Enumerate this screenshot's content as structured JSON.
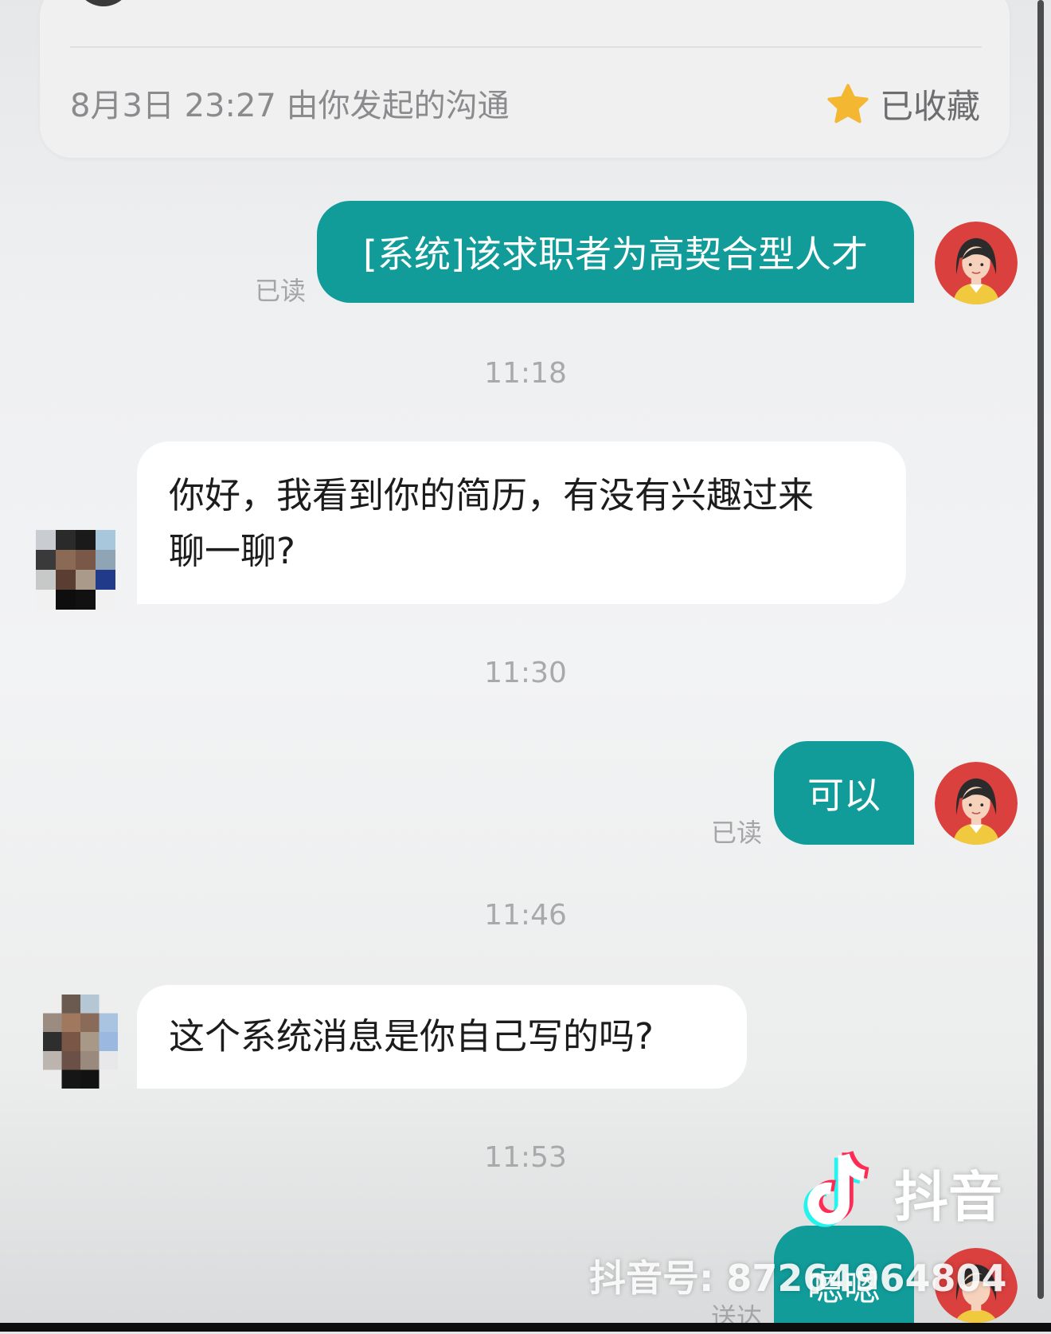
{
  "header": {
    "info_text": "8月3日 23:27 由你发起的沟通",
    "favorite_label": "已收藏",
    "favorite_color": "#f4b731"
  },
  "messages": [
    {
      "side": "out",
      "text": "[系统]该求职者为高契合型人才",
      "status": "已读"
    },
    {
      "type": "time",
      "text": "11:18"
    },
    {
      "side": "in",
      "line1": "你好，我看到你的简历，有没有兴趣过来",
      "line2": "聊一聊?"
    },
    {
      "type": "time",
      "text": "11:30"
    },
    {
      "side": "out",
      "text": "可以",
      "status": "已读"
    },
    {
      "type": "time",
      "text": "11:46"
    },
    {
      "side": "in",
      "text": "这个系统消息是你自己写的吗?"
    },
    {
      "type": "time",
      "text": "11:53"
    },
    {
      "side": "out",
      "text": "嗯嗯",
      "status": "送达"
    }
  ],
  "watermark": {
    "brand": "抖音",
    "account": "抖音号: 87264964804"
  },
  "colors": {
    "accent": "#119c9a",
    "avatar_bg": "#d9403e"
  },
  "icons": {
    "favorite": "star-icon",
    "brand_logo": "tiktok-note-icon"
  }
}
